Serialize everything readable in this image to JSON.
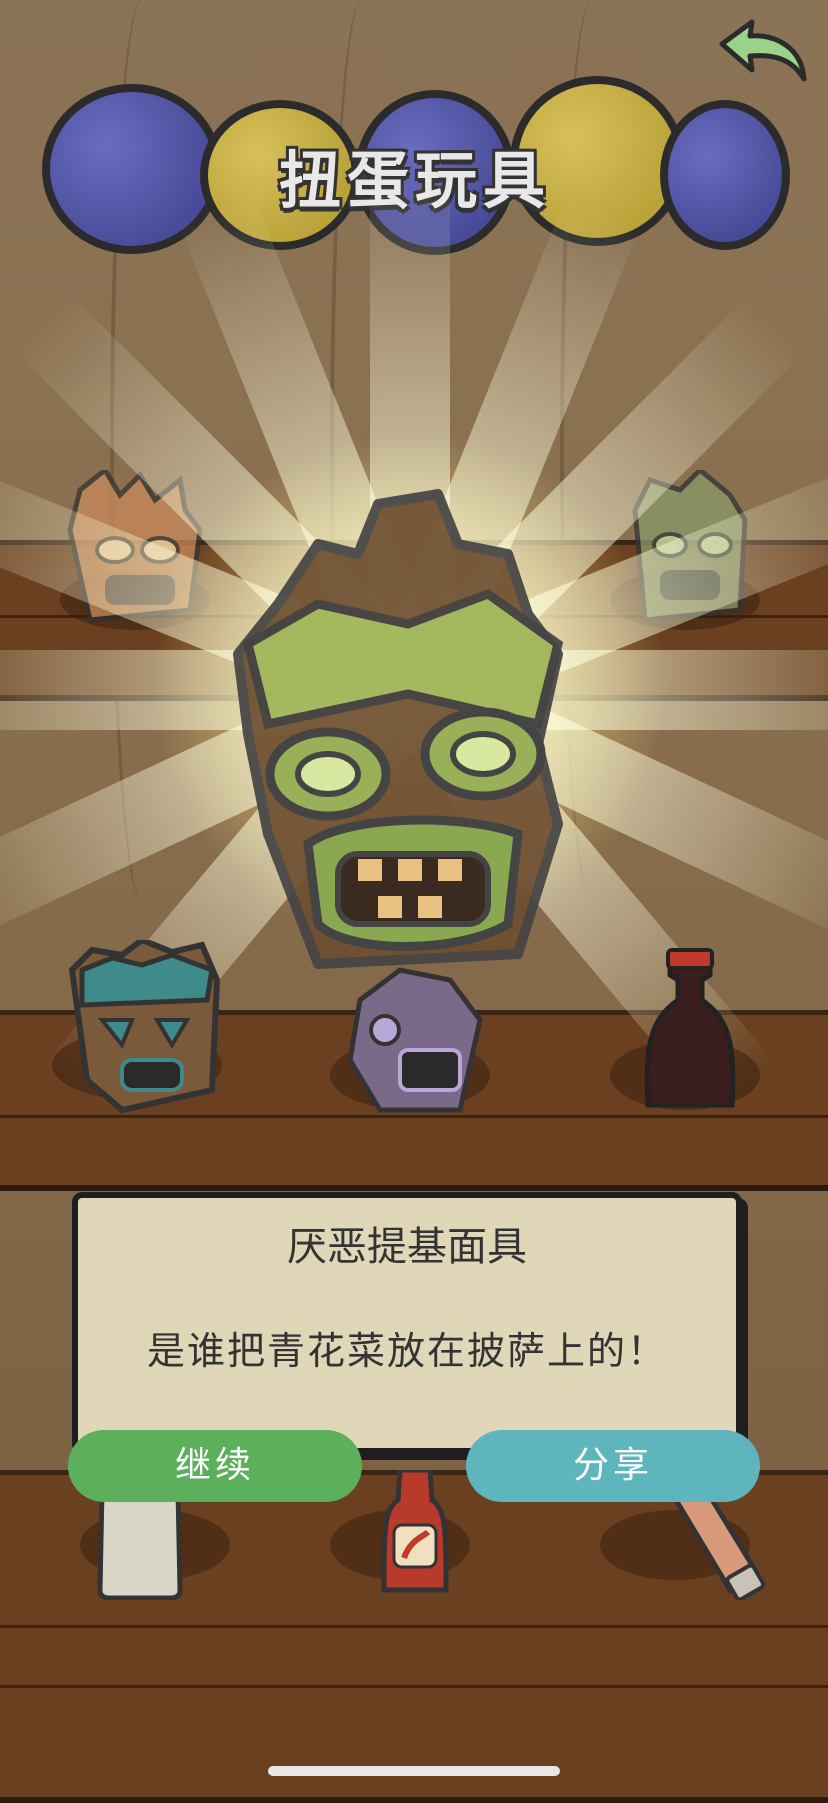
{
  "header": {
    "title": "扭蛋玩具",
    "back_icon": "back-arrow-icon"
  },
  "reveal": {
    "item_icon": "green-tiki-mask-icon"
  },
  "dialog": {
    "item_name": "厌恶提基面具",
    "item_description": "是谁把青花菜放在披萨上的！"
  },
  "buttons": {
    "continue_label": "继续",
    "share_label": "分享"
  },
  "colors": {
    "continue": "#5cb05c",
    "share": "#5fb5bd",
    "dialog_bg": "#e0d6b8"
  }
}
